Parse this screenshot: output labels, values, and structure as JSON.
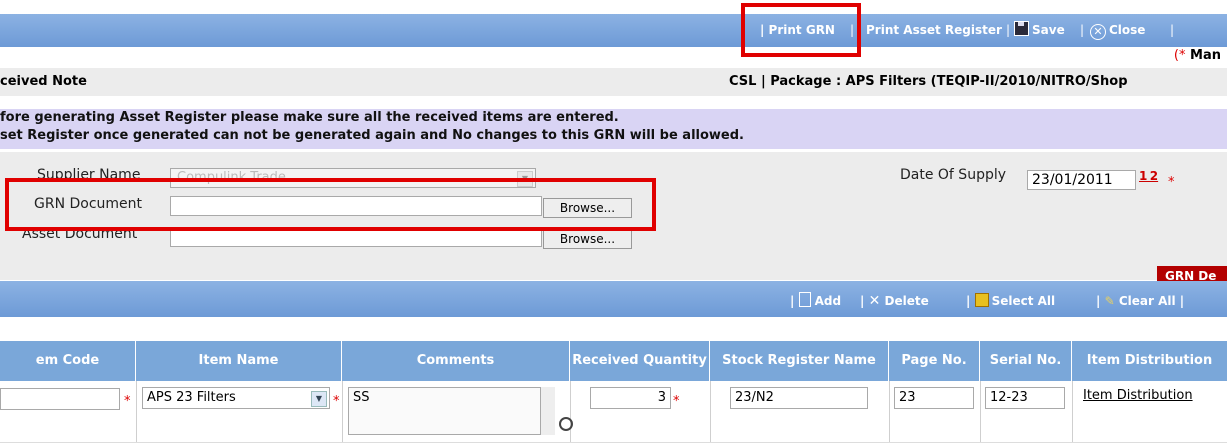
{
  "toolbar": {
    "print_grn": "| Print GRN",
    "sep1": "|",
    "print_asset_register": "Print Asset Register",
    "sep2": "|",
    "save": "Save",
    "sep3": "|",
    "close": "Close",
    "sep4": "|"
  },
  "mandatory_note": {
    "star": "(*",
    "text": " Man"
  },
  "header": {
    "title": "ceived Note",
    "package": "CSL | Package : APS Filters (TEQIP-II/2010/NITRO/Shop"
  },
  "warnings": [
    "fore generating Asset Register please make sure all the received items are entered.",
    "set Register once generated can not be generated again and No changes to this GRN will be allowed."
  ],
  "form": {
    "supplier_label": "Supplier Name",
    "supplier_value": "Compulink Trade",
    "grn_doc_label": "GRN Document",
    "asset_doc_label": "Asset Document",
    "browse_label": "Browse...",
    "date_label": "Date Of Supply",
    "date_value": "23/01/2011",
    "calendar_icon": "1 2",
    "required_mark": "*"
  },
  "grn_details_button": "GRN De",
  "grid_toolbar": {
    "add": "Add",
    "delete": "Delete",
    "select_all": "Select All",
    "clear_all": "Clear All"
  },
  "table": {
    "headers": [
      "em Code",
      "Item Name",
      "Comments",
      "Received Quantity",
      "Stock Register Name",
      "Page No.",
      "Serial No.",
      "Item Distribution"
    ],
    "row": {
      "item_code": "",
      "item_name": "APS 23 Filters",
      "comments": "SS",
      "received_quantity": "3",
      "stock_register_name": "23/N2",
      "page_no": "23",
      "serial_no": "12-23",
      "item_distribution": "Item Distribution"
    }
  },
  "colors": {
    "toolbar": "#7aa4dc",
    "highlight": "#e00000",
    "warning_bg": "#d9d4f4",
    "grn_button": "#b30000"
  }
}
